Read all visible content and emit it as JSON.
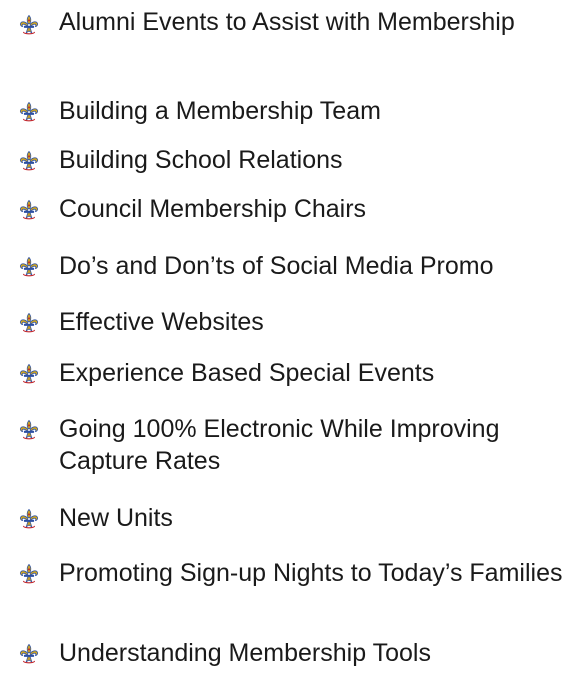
{
  "topics": {
    "items": [
      {
        "label": "Alumni Events to Assist with Membership",
        "icon": "fleur-de-lis-icon"
      },
      {
        "label": "Building a Membership Team",
        "icon": "fleur-de-lis-icon"
      },
      {
        "label": "Building School Relations",
        "icon": "fleur-de-lis-icon"
      },
      {
        "label": "Council Membership Chairs",
        "icon": "fleur-de-lis-icon"
      },
      {
        "label": "Do’s and Don’ts of Social Media Promo",
        "icon": "fleur-de-lis-icon"
      },
      {
        "label": "Effective Websites",
        "icon": "fleur-de-lis-icon"
      },
      {
        "label": "Experience Based Special Events",
        "icon": "fleur-de-lis-icon"
      },
      {
        "label": "Going 100% Electronic While Improving Capture Rates",
        "icon": "fleur-de-lis-icon"
      },
      {
        "label": "New Units",
        "icon": "fleur-de-lis-icon"
      },
      {
        "label": "Promoting Sign-up Nights to Today’s Families",
        "icon": "fleur-de-lis-icon"
      },
      {
        "label": "Understanding Membership Tools",
        "icon": "fleur-de-lis-icon"
      }
    ]
  },
  "colors": {
    "bullet_gold": "#c9a227",
    "bullet_blue": "#2b4fa3",
    "bullet_red": "#c0272d",
    "text": "#1a1a1a"
  }
}
